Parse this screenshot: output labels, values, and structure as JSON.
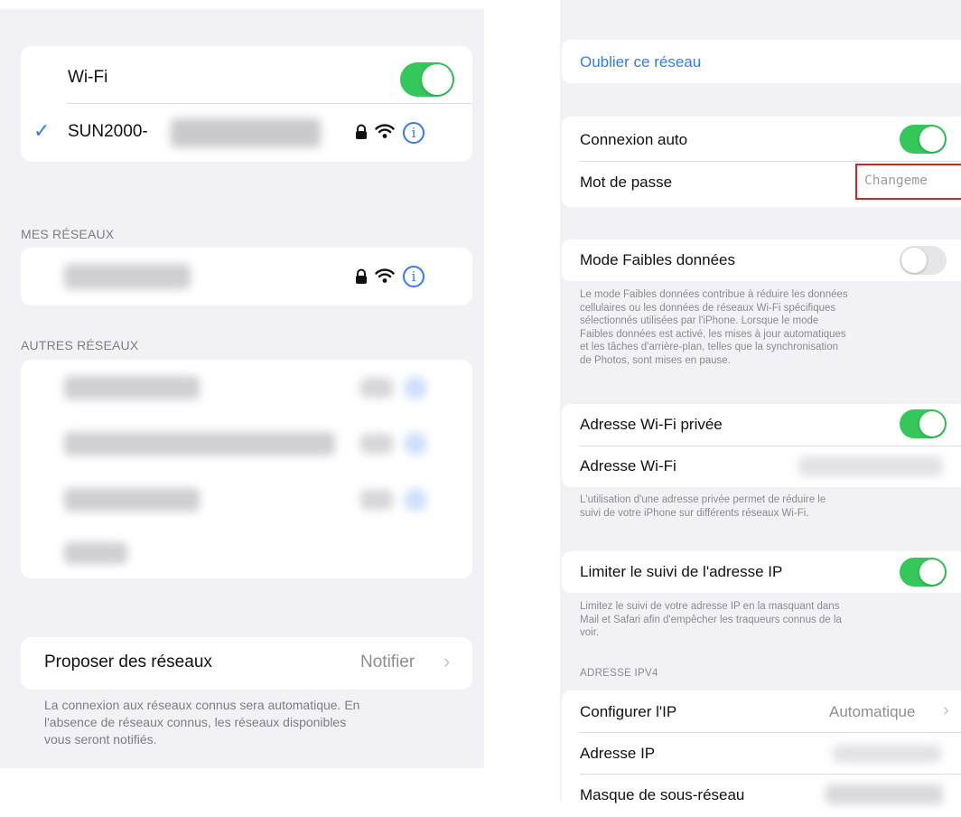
{
  "left": {
    "wifi": {
      "label": "Wi-Fi",
      "enabled": true
    },
    "connected": {
      "check": "✓",
      "ssid": "SUN2000-",
      "icons": [
        "lock-icon",
        "wifi-icon",
        "info-icon"
      ]
    },
    "my_networks_header": "MES RÉSEAUX",
    "other_networks_header": "AUTRES RÉSEAUX",
    "propose": {
      "label": "Proposer des réseaux",
      "value": "Notifier",
      "chevron": "›"
    },
    "footer": [
      "La connexion aux réseaux connus sera automatique. En",
      "l'absence de réseaux connus, les réseaux disponibles",
      "vous seront notifiés."
    ]
  },
  "right": {
    "forget": "Oublier ce réseau",
    "auto_join": {
      "label": "Connexion auto",
      "enabled": true
    },
    "password": {
      "label": "Mot de passe",
      "value": "Changeme"
    },
    "low_data": {
      "label": "Mode Faibles données",
      "enabled": false
    },
    "low_data_footer": [
      "Le mode Faibles données contribue à réduire les données",
      "cellulaires ou les données de réseaux Wi-Fi spécifiques",
      "sélectionnés utilisées par l'iPhone. Lorsque le mode",
      "Faibles données est activé, les mises à jour automatiques",
      "et les tâches d'arrière-plan, telles que la synchronisation",
      "de Photos, sont mises en pause."
    ],
    "private_address": {
      "label": "Adresse Wi-Fi privée",
      "enabled": true
    },
    "wifi_address": {
      "label": "Adresse Wi-Fi"
    },
    "private_footer": [
      "L'utilisation d'une adresse privée permet de réduire le",
      "suivi de votre iPhone sur différents réseaux Wi-Fi."
    ],
    "limit_ip": {
      "label": "Limiter le suivi de l'adresse IP",
      "enabled": true
    },
    "limit_footer": [
      "Limitez le suivi de votre adresse IP en la masquant dans",
      "Mail et Safari afin d'empêcher les traqueurs connus de la",
      "voir."
    ],
    "ipv4_header": "ADRESSE IPV4",
    "configure_ip": {
      "label": "Configurer l'IP",
      "value": "Automatique",
      "chevron": "›"
    },
    "ip_address": {
      "label": "Adresse IP"
    },
    "subnet": {
      "label": "Masque de sous-réseau"
    }
  },
  "colors": {
    "accent": "#2f7cf6",
    "toggle_on": "#34c759",
    "toggle_off": "#e6e6ea",
    "highlight": "#e02020",
    "background": "#f2f2f6"
  }
}
